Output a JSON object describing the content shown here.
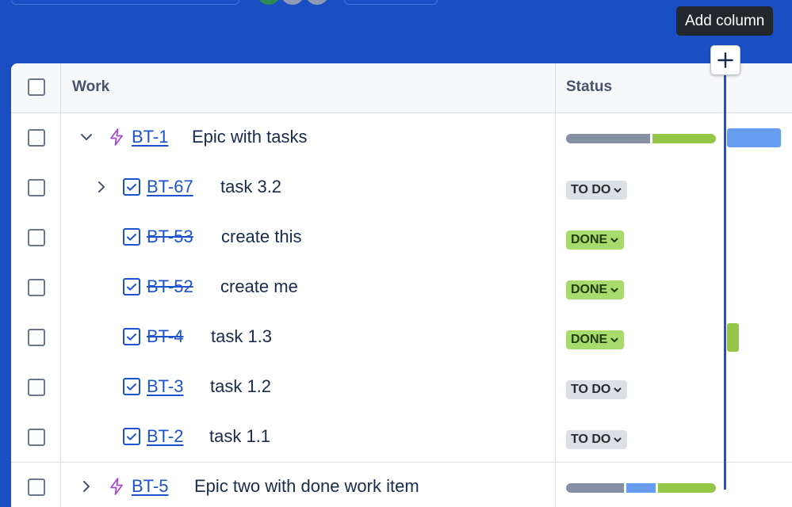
{
  "tooltip": {
    "text": "Add column"
  },
  "table": {
    "headers": {
      "work": "Work",
      "status": "Status"
    },
    "rows": [
      {
        "key": "BT-1",
        "summary": "Epic with tasks",
        "type": "epic",
        "expanded": true,
        "status": "progress",
        "status_label": "",
        "done": false,
        "progress": {
          "todo": 0.56,
          "done": 0.44
        }
      },
      {
        "key": "BT-67",
        "summary": "task 3.2",
        "type": "task",
        "expanded": false,
        "status": "todo",
        "status_label": "TO DO",
        "done": false
      },
      {
        "key": "BT-53",
        "summary": "create this",
        "type": "task",
        "status": "done",
        "status_label": "DONE",
        "done": true
      },
      {
        "key": "BT-52",
        "summary": "create me",
        "type": "task",
        "status": "done",
        "status_label": "DONE",
        "done": true
      },
      {
        "key": "BT-4",
        "summary": "task 1.3",
        "type": "task",
        "status": "done",
        "status_label": "DONE",
        "done": true
      },
      {
        "key": "BT-3",
        "summary": "task 1.2",
        "type": "task",
        "status": "todo",
        "status_label": "TO DO",
        "done": false
      },
      {
        "key": "BT-2",
        "summary": "task 1.1",
        "type": "task",
        "status": "todo",
        "status_label": "TO DO",
        "done": false
      },
      {
        "key": "BT-5",
        "summary": "Epic two with done work item",
        "type": "epic",
        "expanded": false,
        "status": "progress",
        "status_label": "",
        "done": false,
        "progress": {
          "todo": 0.4,
          "inprogress": 0.2,
          "done": 0.4
        }
      }
    ]
  },
  "colors": {
    "accent": "#1d53d0",
    "top_background": "#1a4fc4",
    "todo_segment": "#8590a2",
    "inprogress_segment": "#669df1",
    "done_segment": "#94c748",
    "epic_icon": "#a54ad6",
    "task_icon": "#1d53d0"
  },
  "icons": {
    "expand": "chevron-down-icon",
    "collapse": "chevron-right-icon",
    "epic": "lightning-bolt-icon",
    "task": "checkbox-task-icon",
    "add": "plus-icon",
    "status_dropdown": "chevron-down-icon"
  }
}
